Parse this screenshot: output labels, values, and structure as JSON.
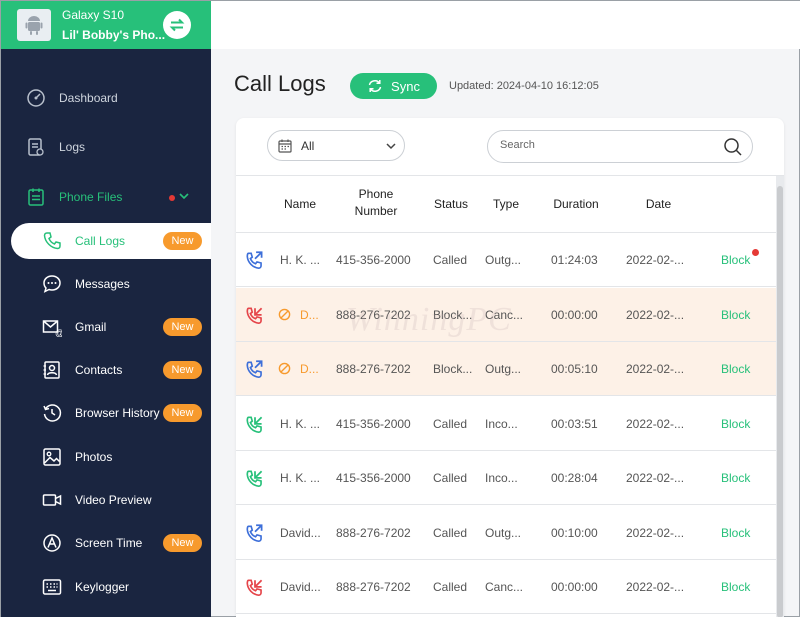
{
  "device": {
    "name": "Galaxy S10",
    "owner": "Lil' Bobby's Pho..."
  },
  "sidebar": {
    "top": [
      {
        "label": "Dashboard",
        "icon": "gauge-icon"
      },
      {
        "label": "Logs",
        "icon": "logs-icon"
      },
      {
        "label": "Phone Files",
        "icon": "phone-files-icon"
      }
    ],
    "sub": [
      {
        "label": "Call Logs",
        "icon": "phone-icon",
        "badge": "New"
      },
      {
        "label": "Messages",
        "icon": "chat-bubble-icon"
      },
      {
        "label": "Gmail",
        "icon": "gmail-icon",
        "badge": "New"
      },
      {
        "label": "Contacts",
        "icon": "contacts-icon",
        "badge": "New"
      },
      {
        "label": "Browser History",
        "icon": "history-icon",
        "badge": "New"
      },
      {
        "label": "Photos",
        "icon": "image-icon"
      },
      {
        "label": "Video Preview",
        "icon": "video-icon"
      },
      {
        "label": "Screen Time",
        "icon": "screen-time-icon",
        "badge": "New"
      },
      {
        "label": "Keylogger",
        "icon": "keyboard-icon"
      }
    ]
  },
  "header": {
    "title": "Call Logs",
    "sync_label": "Sync",
    "updated": "Updated: 2024-04-10 16:12:05"
  },
  "filter": {
    "selected": "All"
  },
  "search": {
    "placeholder": "Search"
  },
  "table": {
    "columns": {
      "name": "Name",
      "phone_1": "Phone",
      "phone_2": "Number",
      "status": "Status",
      "type": "Type",
      "duration": "Duration",
      "date": "Date"
    },
    "rows": [
      {
        "dir": "outgoing",
        "name": "H. K. ...",
        "phone": "415-356-2000",
        "status": "Called",
        "type": "Outg...",
        "duration": "01:24:03",
        "date": "2022-02-...",
        "action": "Block",
        "flag": false,
        "blocked": false
      },
      {
        "dir": "missed",
        "name": "D...",
        "phone": "888-276-7202",
        "status": "Block...",
        "type": "Canc...",
        "duration": "00:00:00",
        "date": "2022-02-...",
        "action": "Block",
        "flag": true,
        "blocked": true
      },
      {
        "dir": "outgoing",
        "name": "D...",
        "phone": "888-276-7202",
        "status": "Block...",
        "type": "Outg...",
        "duration": "00:05:10",
        "date": "2022-02-...",
        "action": "Block",
        "flag": true,
        "blocked": true
      },
      {
        "dir": "incoming",
        "name": "H. K. ...",
        "phone": "415-356-2000",
        "status": "Called",
        "type": "Inco...",
        "duration": "00:03:51",
        "date": "2022-02-...",
        "action": "Block",
        "flag": false,
        "blocked": false
      },
      {
        "dir": "incoming",
        "name": "H. K. ...",
        "phone": "415-356-2000",
        "status": "Called",
        "type": "Inco...",
        "duration": "00:28:04",
        "date": "2022-02-...",
        "action": "Block",
        "flag": false,
        "blocked": false
      },
      {
        "dir": "outgoing",
        "name": "David...",
        "phone": "888-276-7202",
        "status": "Called",
        "type": "Outg...",
        "duration": "00:10:00",
        "date": "2022-02-...",
        "action": "Block",
        "flag": false,
        "blocked": false
      },
      {
        "dir": "missed",
        "name": "David...",
        "phone": "888-276-7202",
        "status": "Called",
        "type": "Canc...",
        "duration": "00:00:00",
        "date": "2022-02-...",
        "action": "Block",
        "flag": false,
        "blocked": false
      }
    ]
  },
  "watermark": "WinningPC",
  "colors": {
    "accent": "#27c07a",
    "sidebar": "#1a2540",
    "badge": "#f79a2d",
    "alert": "#e53935",
    "outgoing": "#3d6fd9",
    "incoming": "#27c07a",
    "missed": "#e5454a"
  }
}
